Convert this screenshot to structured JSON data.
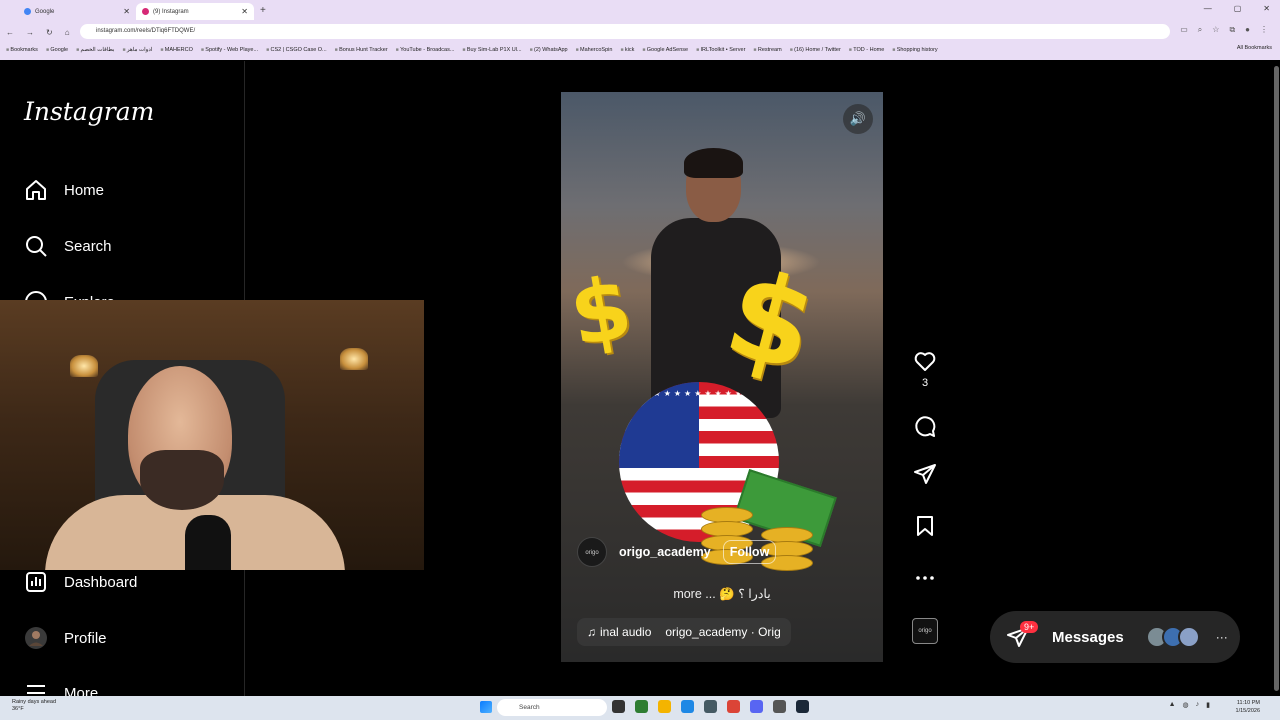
{
  "browser": {
    "tabs": [
      {
        "label": "Google",
        "active": false
      },
      {
        "label": "(9) Instagram",
        "active": true
      }
    ],
    "new_tab": "+",
    "url": "instagram.com/reels/DTiq6FTDQWE/",
    "bookmarks": [
      "Bookmarks",
      "Google",
      "بطاقات الخصم",
      "ادوات ماهر",
      "MAHERCO",
      "Spotify - Web Playe...",
      "CS2 | CSGO Case O...",
      "Bonus Hunt Tracker",
      "YouTube - Broadcas...",
      "Buy Sim-Lab P1X Ul...",
      "(2) WhatsApp",
      "MahercoSpin",
      "kick",
      "Google AdSense",
      "IRLToolkit • Server",
      "Restream",
      "(16) Home / Twitter",
      "TOD - Home",
      "Shopping history"
    ],
    "all_bookmarks": "All Bookmarks"
  },
  "instagram": {
    "logo": "Instagram",
    "nav": {
      "home": "Home",
      "search": "Search",
      "explore": "Explore",
      "dashboard": "Dashboard",
      "profile": "Profile",
      "more": "More"
    },
    "reel": {
      "author": "origo_academy",
      "follow": "Follow",
      "caption": "more ... 🤔 يادرا ؟",
      "audio_prefix": "inal audio",
      "audio_author": "origo_academy · Orig",
      "avatar_text": "origo"
    },
    "actions": {
      "likes": "3"
    },
    "messages": {
      "label": "Messages",
      "badge": "9+"
    }
  },
  "taskbar": {
    "weather_line1": "Rainy days ahead",
    "weather_line2": "36°F",
    "search": "Search",
    "time": "11:10 PM",
    "date": "1/15/2026"
  },
  "colors": {
    "background": "#000000",
    "accent_badge": "#ff3040",
    "chrome_bg": "#e9ddf5"
  }
}
